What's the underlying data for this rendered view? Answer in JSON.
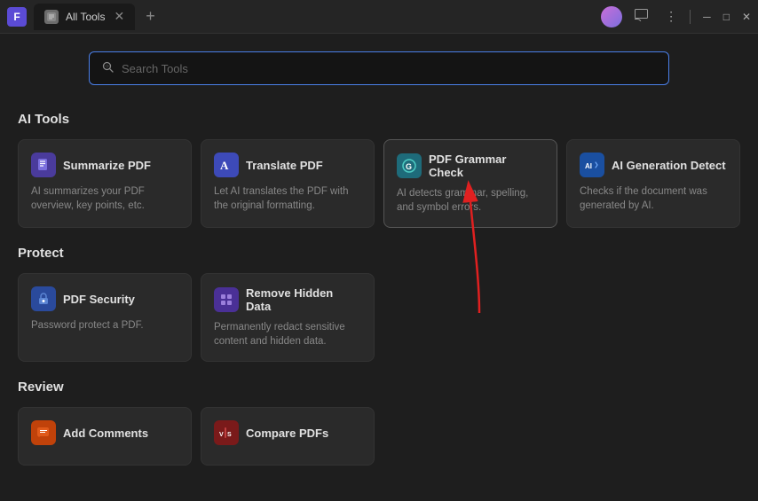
{
  "titlebar": {
    "app_icon_label": "F",
    "tab_icon": "🔒",
    "tab_title": "All Tools",
    "tab_close": "✕",
    "tab_add": "+",
    "more_btn": "⋮",
    "minimize": "─",
    "maximize": "□",
    "close": "✕"
  },
  "search": {
    "placeholder": "Search Tools"
  },
  "sections": {
    "ai_tools": {
      "title": "AI Tools",
      "tools": [
        {
          "name": "Summarize PDF",
          "desc": "AI summarizes your PDF overview, key points, etc.",
          "icon": "📄",
          "icon_class": "icon-purple"
        },
        {
          "name": "Translate PDF",
          "desc": "Let AI translates the PDF with the original formatting.",
          "icon": "A",
          "icon_class": "icon-blue-purple"
        },
        {
          "name": "PDF Grammar Check",
          "desc": "AI detects grammar, spelling, and symbol errors.",
          "icon": "G",
          "icon_class": "icon-teal"
        },
        {
          "name": "AI Generation Detect",
          "desc": "Checks if the document was generated by AI.",
          "icon": "AI",
          "icon_class": "icon-ai-blue"
        }
      ]
    },
    "protect": {
      "title": "Protect",
      "tools": [
        {
          "name": "PDF Security",
          "desc": "Password protect a PDF.",
          "icon": "🔒",
          "icon_class": "icon-lock"
        },
        {
          "name": "Remove Hidden Data",
          "desc": "Permanently redact sensitive content and hidden data.",
          "icon": "⊞",
          "icon_class": "icon-grid-purple"
        }
      ]
    },
    "review": {
      "title": "Review",
      "tools": [
        {
          "name": "Add Comments",
          "desc": "",
          "icon": "💬",
          "icon_class": "icon-orange"
        },
        {
          "name": "Compare PDFs",
          "desc": "",
          "icon": "VS",
          "icon_class": "icon-compare"
        }
      ]
    }
  }
}
